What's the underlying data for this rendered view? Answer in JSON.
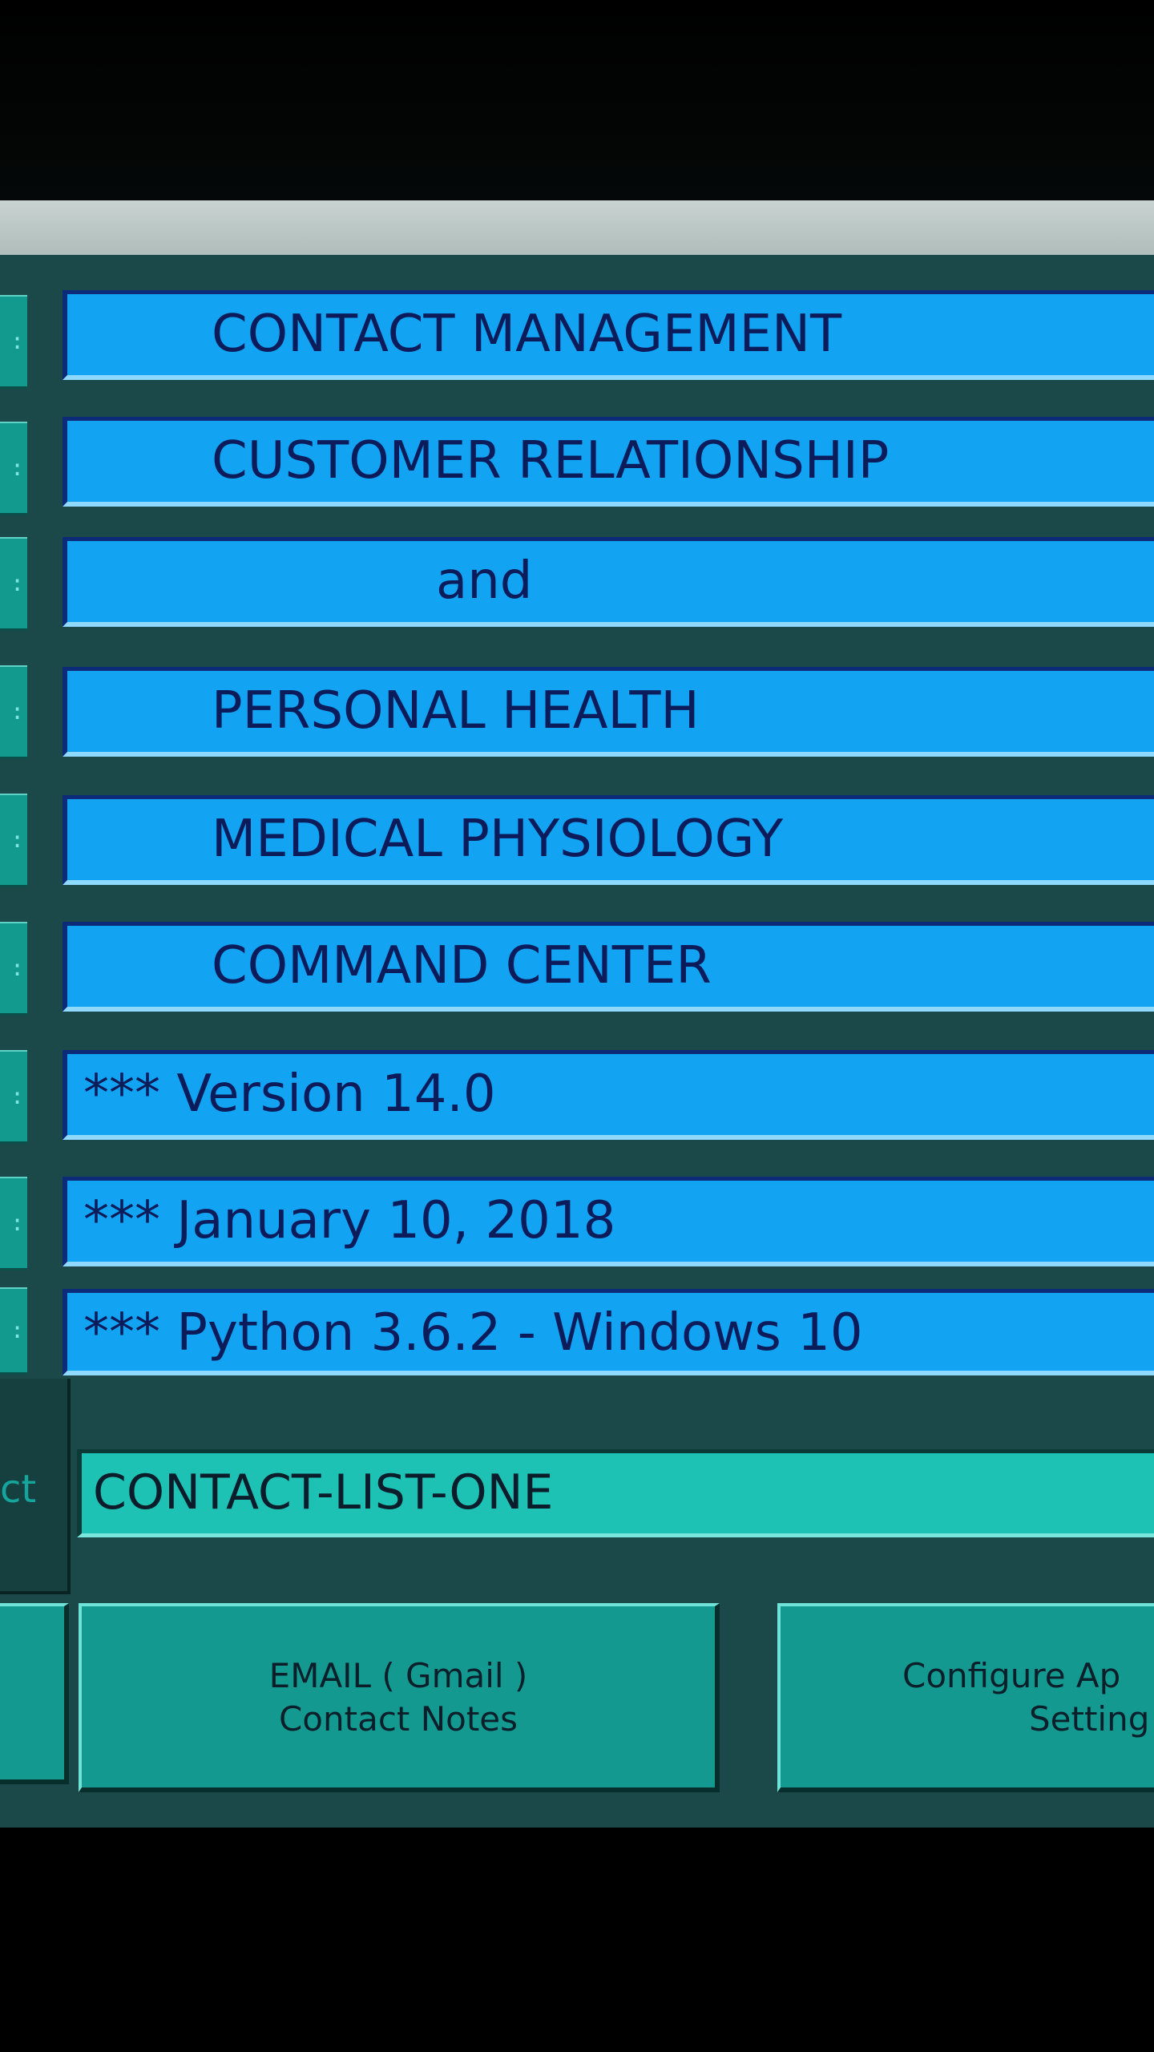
{
  "header": {
    "title_lines": [
      "CONTACT MANAGEMENT",
      "CUSTOMER RELATIONSHIP",
      "and",
      "PERSONAL HEALTH",
      "MEDICAL PHYSIOLOGY",
      "COMMAND CENTER"
    ]
  },
  "info": {
    "version": "*** Version 14.0",
    "date": "*** January 10, 2018",
    "platform": "*** Python 3.6.2 - Windows 10"
  },
  "contact_list": {
    "label_partial": "ct",
    "value": "CONTACT-LIST-ONE"
  },
  "buttons": {
    "email_line1": "EMAIL  ( Gmail )",
    "email_line2": "Contact Notes",
    "config_line1": "Configure Ap",
    "config_line2": "Setting"
  },
  "side_tabs": {
    "dots": ":"
  },
  "colors": {
    "title_bar": "#12a3f2",
    "title_text": "#0c1c5a",
    "screen_background": "#1b4848",
    "button_teal": "#13998f",
    "contact_field": "#1ec2b4"
  }
}
